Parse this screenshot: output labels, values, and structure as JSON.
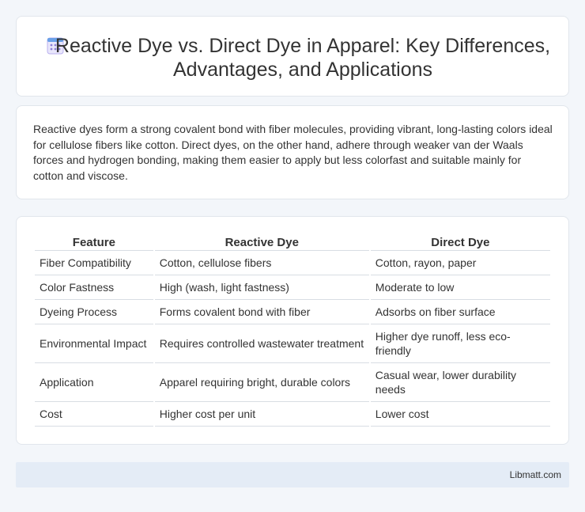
{
  "header": {
    "icon": "calendar-icon",
    "title": "Reactive Dye vs. Direct Dye in Apparel: Key Differences, Advantages, and Applications"
  },
  "intro": {
    "text": "Reactive dyes form a strong covalent bond with fiber molecules, providing vibrant, long-lasting colors ideal for cellulose fibers like cotton. Direct dyes, on the other hand, adhere through weaker van der Waals forces and hydrogen bonding, making them easier to apply but less colorfast and suitable mainly for cotton and viscose."
  },
  "table": {
    "headers": [
      "Feature",
      "Reactive Dye",
      "Direct Dye"
    ],
    "rows": [
      [
        "Fiber Compatibility",
        "Cotton, cellulose fibers",
        "Cotton, rayon, paper"
      ],
      [
        "Color Fastness",
        "High (wash, light fastness)",
        "Moderate to low"
      ],
      [
        "Dyeing Process",
        "Forms covalent bond with fiber",
        "Adsorbs on fiber surface"
      ],
      [
        "Environmental Impact",
        "Requires controlled wastewater treatment",
        "Higher dye runoff, less eco-friendly"
      ],
      [
        "Application",
        "Apparel requiring bright, durable colors",
        "Casual wear, lower durability needs"
      ],
      [
        "Cost",
        "Higher cost per unit",
        "Lower cost"
      ]
    ]
  },
  "footer": {
    "site": "Libmatt.com"
  },
  "colors": {
    "background": "#f3f6fa",
    "footer_bg": "#e4ecf6",
    "icon_accent": "#8b7fd6"
  }
}
